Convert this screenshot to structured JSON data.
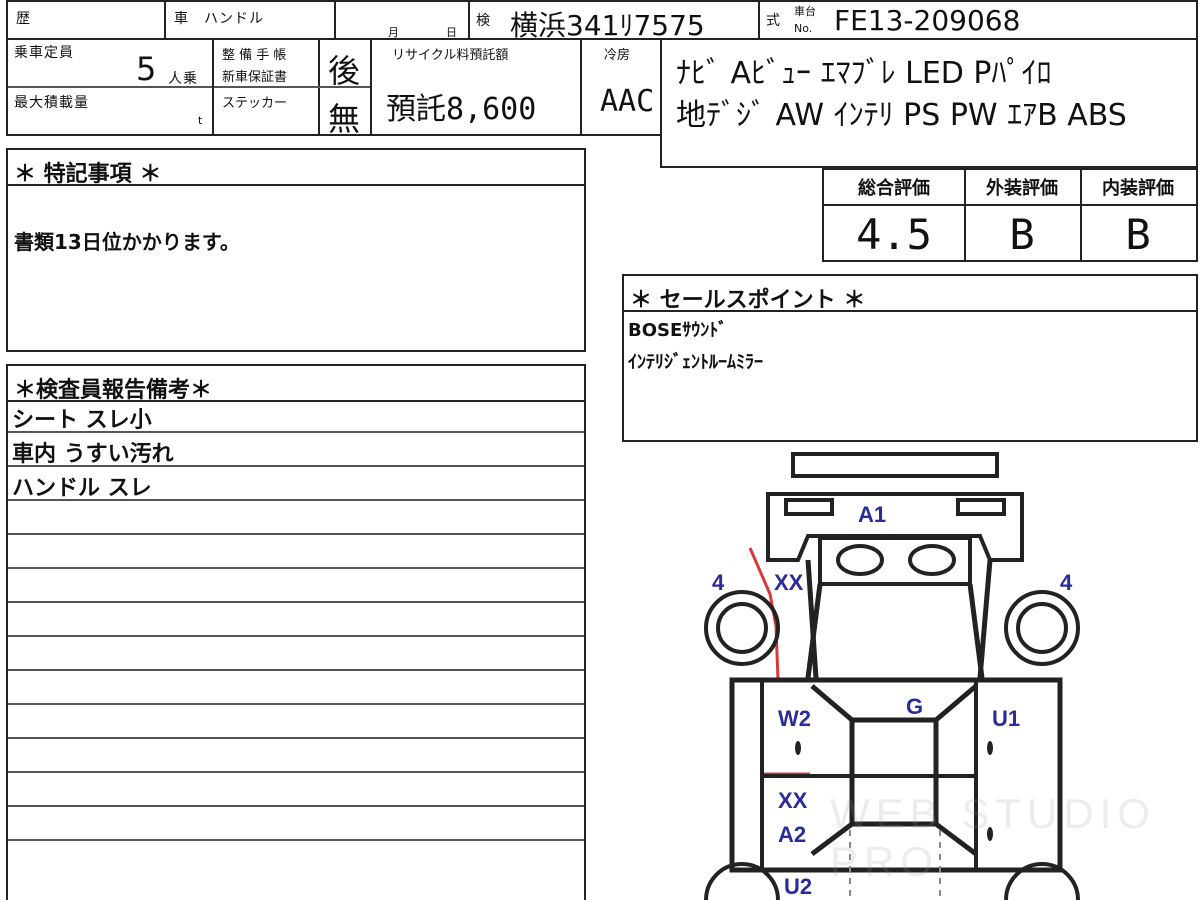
{
  "top_fields": {
    "history_label": "歴",
    "car_label": "車",
    "handle_label": "ハンドル",
    "month_label": "月",
    "day_label": "日",
    "inspection_label": "検",
    "plate_value": "横浜341ﾘ7575",
    "model_label": "式",
    "chassis_label_top": "車台",
    "chassis_label_bottom": "No.",
    "chassis_value": "FE13-209068"
  },
  "row2": {
    "capacity_label": "乗車定員",
    "capacity_value": "5",
    "capacity_unit": "人乗",
    "maint_label_1": "整 備 手 帳",
    "maint_label_2": "新車保証書",
    "maint_value": "後",
    "sticker_label": "ステッカー",
    "sticker_value": "無",
    "recycle_label": "リサイクル料預託額",
    "recycle_value": "預託8,600",
    "ac_label": "冷房",
    "ac_value": "AAC",
    "max_load_label": "最大積載量",
    "max_load_unit": "t"
  },
  "equipment": {
    "line1": "ﾅﾋﾞ Aﾋﾞｭｰ ｴﾏﾌﾞﾚ LED Pﾊﾟｲﾛ",
    "line2": "地ﾃﾞｼﾞ AW ｲﾝﾃﾘ PS PW ｴｱB ABS"
  },
  "grades": {
    "overall_label": "総合評価",
    "overall_value": "4.5",
    "exterior_label": "外装評価",
    "exterior_value": "B",
    "interior_label": "内装評価",
    "interior_value": "B"
  },
  "special_notes": {
    "header": "＊ 特記事項 ＊",
    "text": "書類13日位かかります。"
  },
  "sales_points": {
    "header": "＊ セールスポイント ＊",
    "items": [
      "BOSEｻｳﾝﾄﾞ",
      "ｲﾝﾃﾘｼﾞｪﾝﾄﾙｰﾑﾐﾗｰ"
    ]
  },
  "inspector_notes": {
    "header": "＊検査員報告備考＊",
    "rows": [
      "シート スレ小",
      "車内 うすい汚れ",
      "ハンドル スレ",
      "",
      "",
      "",
      "",
      "",
      "",
      "",
      "",
      "",
      ""
    ]
  },
  "damage_marks": {
    "a1": "A1",
    "xx_front": "XX",
    "four_left": "4",
    "four_right": "4",
    "w2": "W2",
    "g": "G",
    "u1": "U1",
    "xx_side": "XX",
    "a2": "A2",
    "u2": "U2",
    "mark_color": "#2b2b9a",
    "damage_outline_color": "#d63a3a"
  },
  "watermark": "WEB STUDIO PRO"
}
